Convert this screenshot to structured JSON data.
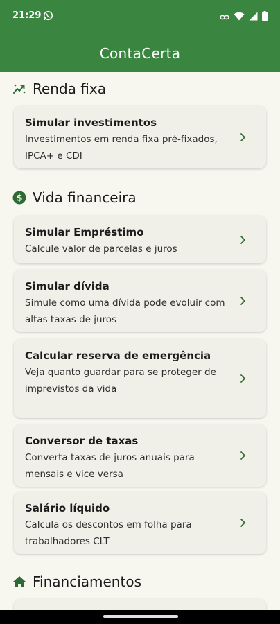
{
  "status_bar": {
    "time": "21:29",
    "left_icons": [
      "whatsapp-icon"
    ],
    "right_icons": [
      "link-icon",
      "wifi-icon",
      "signal-icon",
      "battery-icon"
    ]
  },
  "app_bar": {
    "title": "ContaCerta"
  },
  "colors": {
    "primary": "#3a8540",
    "icon_green": "#2e6b34",
    "background": "#f7f6ef",
    "card": "#f1f0e8"
  },
  "sections": [
    {
      "title": "Renda fixa",
      "icon": "trending-up-icon",
      "cards": [
        {
          "title": "Simular investimentos",
          "description": "Investimentos em renda fixa pré-fixados, IPCA+ e CDI"
        }
      ]
    },
    {
      "title": "Vida financeira",
      "icon": "dollar-circle-icon",
      "cards": [
        {
          "title": "Simular Empréstimo",
          "description": "Calcule valor de parcelas e juros"
        },
        {
          "title": "Simular dívida",
          "description": "Simule como uma dívida pode evoluir com altas taxas de juros"
        },
        {
          "title": "Calcular reserva de emergência",
          "description": "Veja quanto guardar para se proteger de imprevistos da vida"
        },
        {
          "title": "Conversor de taxas",
          "description": "Converta taxas de juros anuais para mensais e vice versa"
        },
        {
          "title": "Salário líquido",
          "description": "Calcula os descontos em folha para trabalhadores CLT"
        }
      ]
    },
    {
      "title": "Financiamentos",
      "icon": "home-icon",
      "cards": []
    }
  ]
}
